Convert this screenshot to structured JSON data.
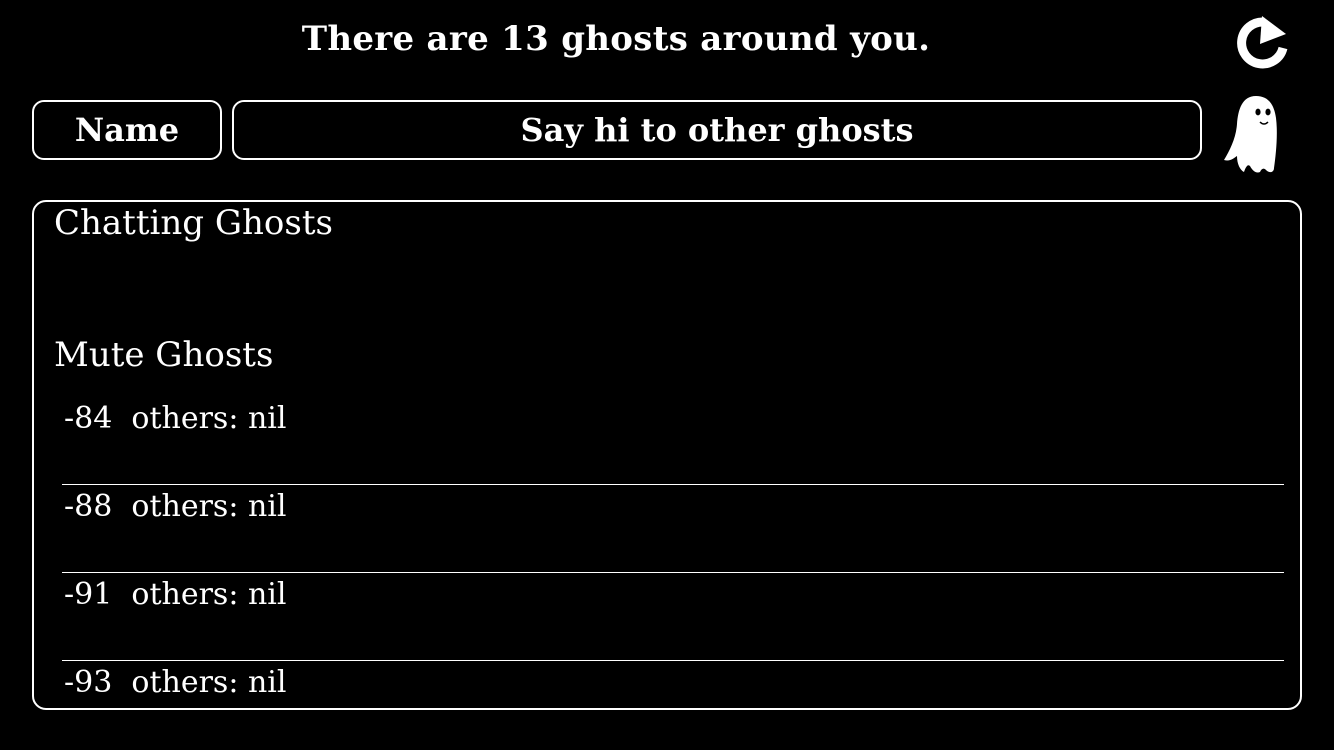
{
  "header": {
    "title": "There are 13 ghosts around you.",
    "refresh_icon": "refresh-icon"
  },
  "inputs": {
    "name_placeholder": "Name",
    "message_placeholder": "Say hi to other ghosts"
  },
  "ghost_icon": "ghost-icon",
  "panel": {
    "chatting_title": "Chatting Ghosts",
    "chatting_items": [],
    "mute_title": "Mute Ghosts",
    "mute_items": [
      {
        "rssi": "-84",
        "text": "others: nil"
      },
      {
        "rssi": "-88",
        "text": "others: nil"
      },
      {
        "rssi": "-91",
        "text": "others: nil"
      },
      {
        "rssi": "-93",
        "text": "others: nil"
      }
    ]
  },
  "colors": {
    "background": "#000000",
    "foreground": "#ffffff"
  }
}
